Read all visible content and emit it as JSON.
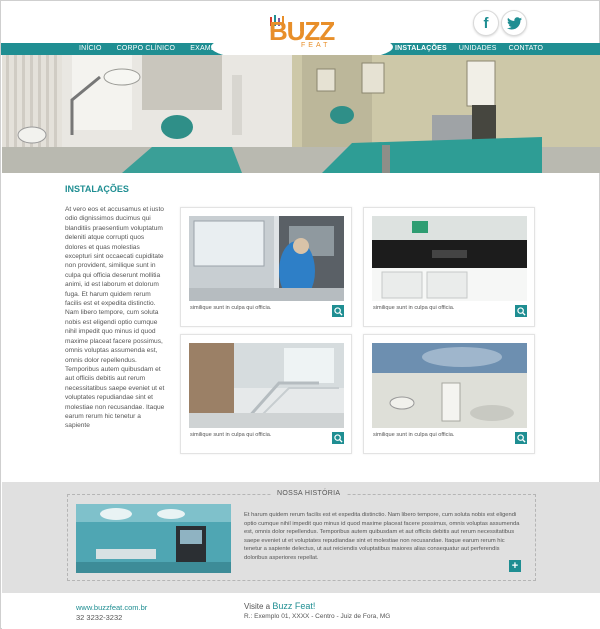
{
  "colors": {
    "brand_teal": "#1f8e92",
    "logo_orange": "#e88f2a",
    "band_gray": "#e0e0e0"
  },
  "header": {
    "logo": {
      "text": "BUZZ",
      "subtext": "FEAT"
    },
    "social": [
      {
        "name": "facebook-icon",
        "glyph": "f"
      },
      {
        "name": "twitter-icon",
        "glyph": "bird"
      }
    ]
  },
  "nav": {
    "left": [
      "INÍCIO",
      "CORPO CLÍNICO",
      "EXAMES"
    ],
    "right": [
      "INSTALAÇÕES",
      "UNIDADES",
      "CONTATO"
    ],
    "active": "INSTALAÇÕES"
  },
  "main": {
    "title": "INSTALAÇÕES",
    "intro": "At vero eos et accusamus et iusto odio dignissimos ducimus qui blanditiis praesentium voluptatum deleniti atque corrupti quos dolores et quas molestias excepturi sint occaecati cupiditate non provident, similique sunt in culpa qui officia deserunt mollitia animi, id est laborum et dolorum fuga. Et harum quidem rerum facilis est et expedita distinctio. Nam libero tempore, cum soluta nobis est eligendi optio cumque nihil impedit quo minus id quod maxime placeat facere possimus, omnis voluptas assumenda est, omnis dolor repellendus. Temporibus autem quibusdam et aut officiis debitis aut rerum necessitatibus saepe eveniet ut et voluptates repudiandae sint et molestiae non recusandae. Itaque earum rerum hic tenetur a sapiente",
    "gallery": [
      {
        "caption": "similique sunt in culpa qui officia."
      },
      {
        "caption": "similique sunt in culpa qui officia."
      },
      {
        "caption": "similique sunt in culpa qui officia."
      },
      {
        "caption": "similique sunt in culpa qui officia."
      }
    ]
  },
  "story": {
    "title": "NOSSA HISTÓRIA",
    "text": "Et harum quidem rerum facilis est et expedita distinctio. Nam libero tempore, cum soluta nobis est eligendi optio cumque nihil impedit quo minus id quod maxime placeat facere possimus, omnis voluptas assumenda est, omnis dolor repellendus. Temporibus autem quibusdam et aut officiis debitis aut rerum necessitatibus saepe eveniet ut et voluptates repudiandae sint et molestiae non recusandae. Itaque earum rerum hic tenetur a sapiente delectus, ut aut reiciendis voluptatibus maiores alias consequatur aut perferendis doloribus asperiores repellat.",
    "more_label": "+"
  },
  "footer": {
    "url": "www.buzzfeat.com.br",
    "phone": "32 3232-3232",
    "visit_prefix": "Visite a",
    "visit_brand": "Buzz Feat!",
    "address": "R.: Exemplo 01, XXXX - Centro - Juiz de Fora, MG"
  }
}
